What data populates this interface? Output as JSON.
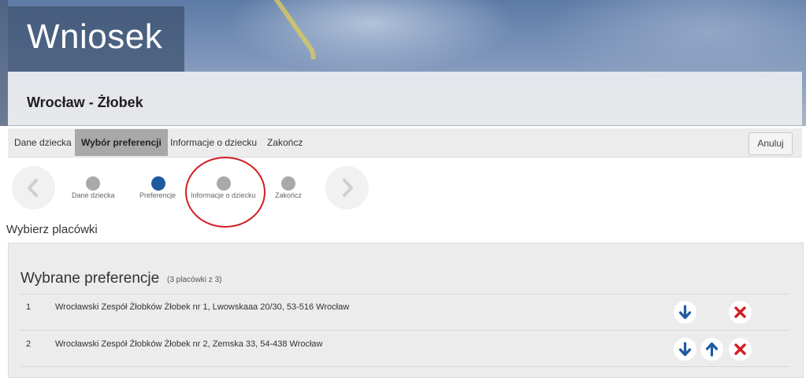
{
  "header": {
    "title": "Wniosek",
    "subtitle": "Wrocław - Żłobek"
  },
  "tabs": [
    {
      "label": "Dane dziecka",
      "active": false
    },
    {
      "label": "Wybór preferencji",
      "active": true
    },
    {
      "label": "Informacje o dziecku",
      "active": false
    },
    {
      "label": "Zakończ",
      "active": false
    }
  ],
  "cancel_label": "Anuluj",
  "stepper": {
    "prev_icon": "chevron-left-icon",
    "next_icon": "chevron-right-icon",
    "steps": [
      {
        "label": "Dane dziecka",
        "active": false
      },
      {
        "label": "Preferencje",
        "active": true
      },
      {
        "label": "Informacje o dziecku",
        "active": false
      },
      {
        "label": "Zakończ",
        "active": false
      }
    ]
  },
  "section_label": "Wybierz placówki",
  "preferences": {
    "title": "Wybrane preferencje",
    "count": "(3 placówki z 3)",
    "rows": [
      {
        "number": "1",
        "name": "Wrocławski Zespół Żłobków Żłobek nr 1, Lwowskaaa 20/30, 53-516 Wrocław",
        "actions": [
          "arrow-down-icon",
          "remove-icon"
        ]
      },
      {
        "number": "2",
        "name": "Wrocławski Zespół Żłobków Żłobek nr 2, Zemska 33, 54-438 Wrocław",
        "actions": [
          "arrow-down-icon",
          "arrow-up-icon",
          "remove-icon"
        ]
      }
    ]
  },
  "colors": {
    "accent": "#1f5aa0",
    "danger": "#d21e24",
    "active_tab": "#a8a8a8"
  }
}
